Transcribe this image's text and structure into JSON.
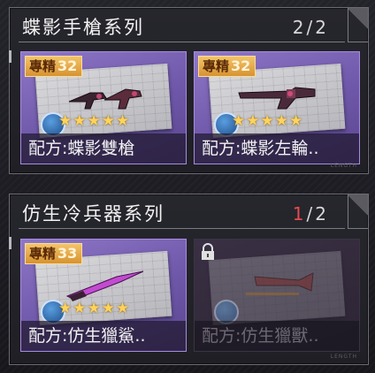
{
  "series": [
    {
      "title": "蝶影手槍系列",
      "count_current": "2",
      "count_sep": "/",
      "count_total": "2",
      "cards": [
        {
          "badge_label": "專精",
          "badge_level": "32",
          "name": "配方:蝶影雙槍",
          "stars": 5,
          "locked": false
        },
        {
          "badge_label": "專精",
          "badge_level": "32",
          "name": "配方:蝶影左輪..",
          "stars": 5,
          "locked": false
        }
      ]
    },
    {
      "title": "仿生冷兵器系列",
      "count_current": "1",
      "count_sep": "/",
      "count_total": "2",
      "cards": [
        {
          "badge_label": "專精",
          "badge_level": "33",
          "name": "配方:仿生獵鯊..",
          "stars": 5,
          "locked": false
        },
        {
          "name": "配方:仿生獵獸..",
          "locked": true
        }
      ]
    }
  ],
  "footer_mark": "LENGTH",
  "colors": {
    "card_purple": "#7b63b8",
    "badge_orange": "#e4a848",
    "count_red": "#e64a50",
    "star_gold": "#ffd35a"
  },
  "icons": [
    "lock-icon",
    "tool-icon",
    "star-icon"
  ]
}
